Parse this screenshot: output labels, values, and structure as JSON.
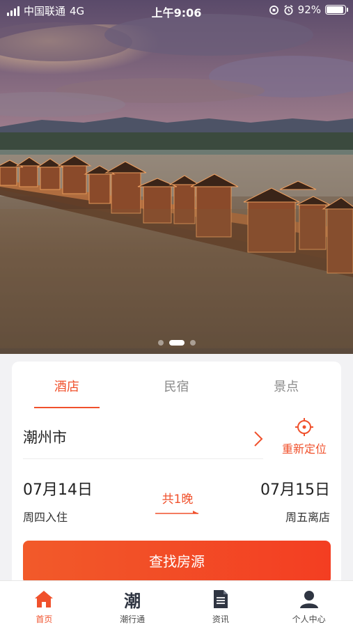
{
  "status_bar": {
    "carrier": "中国联通",
    "network": "4G",
    "time": "上午9:06",
    "battery_percent": "92%",
    "battery_level": 0.92
  },
  "hero": {
    "carousel_dots": 3,
    "active_index": 1
  },
  "booking": {
    "tabs": [
      {
        "label": "酒店",
        "active": true
      },
      {
        "label": "民宿",
        "active": false
      },
      {
        "label": "景点",
        "active": false
      }
    ],
    "city": "潮州市",
    "arrow_icon": "chevron-right-icon",
    "relocate_label": "重新定位",
    "checkin": {
      "date": "07月14日",
      "label": "周四入住"
    },
    "checkout": {
      "date": "07月15日",
      "label": "周五离店"
    },
    "nights": "共1晚",
    "search_label": "查找房源"
  },
  "tab_bar": {
    "items": [
      {
        "label": "首页",
        "icon": "home-icon",
        "active": true
      },
      {
        "label": "潮行通",
        "icon_text": "潮",
        "active": false
      },
      {
        "label": "资讯",
        "icon": "document-icon",
        "active": false
      },
      {
        "label": "个人中心",
        "icon": "user-icon",
        "active": false
      }
    ]
  },
  "colors": {
    "accent": "#f0512c",
    "button_start": "#f25a2a",
    "button_end": "#f33e22"
  }
}
